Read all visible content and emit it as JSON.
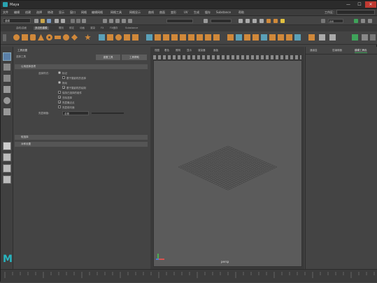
{
  "window": {
    "title": "Maya",
    "minimize": "—",
    "maximize": "☐",
    "close": "✕"
  },
  "menubar": {
    "items": [
      "文件",
      "编辑",
      "创建",
      "选择",
      "修改",
      "显示",
      "窗口",
      "网格",
      "编辑网格",
      "网格工具",
      "网格显示",
      "曲线",
      "曲面",
      "变形",
      "UV",
      "生成",
      "缓存",
      "Substance",
      "帮助"
    ],
    "workspace_label": "工作区："
  },
  "statusline": {
    "mode": "建模",
    "search": "符号"
  },
  "shelf": {
    "tabs": [
      "曲线/曲面",
      "多边形建模",
      "雕刻",
      "绑定",
      "动画",
      "渲染",
      "FX",
      "FX缓存",
      "Substance"
    ],
    "active": "多边形建模"
  },
  "tool_settings": {
    "title": "工具设置",
    "tool_name": "选择工具",
    "reset_button": "重置工具",
    "help_button": "工具帮助",
    "section_common": "公用选择选项",
    "select_by_label": "选择样式：",
    "options": [
      {
        "label": "标记",
        "checked": false
      },
      {
        "label": "基于摄影机的选择",
        "checked": false
      },
      {
        "label": "拖动",
        "checked": false
      },
      {
        "label": "基于摄影机的绘制",
        "checked": true
      },
      {
        "label": "保持已选择的组件",
        "checked": false
      },
      {
        "label": "去除选择",
        "checked": true
      },
      {
        "label": "亮显最近点",
        "checked": true
      },
      {
        "label": "亮显前向面",
        "checked": false
      }
    ],
    "preselect_label": "亮显阈值：",
    "preselect_value": "总是",
    "section_soft": "软选择",
    "section_symmetry": "对称设置"
  },
  "viewport": {
    "menus": [
      "视图",
      "着色",
      "照明",
      "显示",
      "渲染器",
      "面板"
    ],
    "camera_label": "persp",
    "axis_label": "Y"
  },
  "right_panel": {
    "tabs": [
      "通道盒",
      "层编辑器",
      "建模工具包"
    ],
    "active": "建模工具包"
  },
  "logo": "M"
}
